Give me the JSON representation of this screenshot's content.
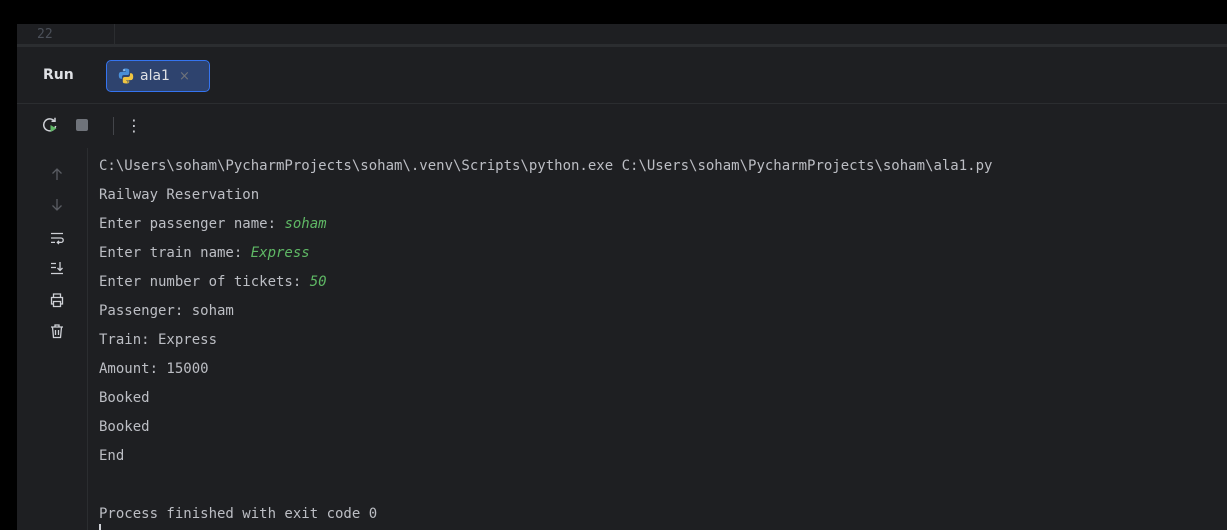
{
  "editor": {
    "line_number": "22"
  },
  "tool_window": {
    "title": "Run",
    "tab": {
      "label": "ala1",
      "icon": "python-icon",
      "close_glyph": "×"
    }
  },
  "toolbar": {
    "rerun_icon": "rerun-icon",
    "stop_icon": "stop-icon",
    "more_glyph": "⋮"
  },
  "side_actions": [
    {
      "name": "scroll-up-icon"
    },
    {
      "name": "scroll-down-icon"
    },
    {
      "name": "soft-wrap-icon"
    },
    {
      "name": "scroll-to-end-icon"
    },
    {
      "name": "print-icon"
    },
    {
      "name": "clear-all-icon"
    }
  ],
  "console": {
    "command": "C:\\Users\\soham\\PycharmProjects\\soham\\.venv\\Scripts\\python.exe C:\\Users\\soham\\PycharmProjects\\soham\\ala1.py",
    "line_heading": "Railway Reservation",
    "prompt_name": "Enter passenger name: ",
    "input_name": "soham",
    "prompt_train": "Enter train name: ",
    "input_train": "Express",
    "prompt_tickets": "Enter number of tickets: ",
    "input_tickets": "50",
    "out_passenger": "Passenger: soham",
    "out_train": "Train: Express",
    "out_amount": "Amount: 15000",
    "out_booked_1": "Booked",
    "out_booked_2": "Booked",
    "out_end": "End",
    "exit_message": "Process finished with exit code 0"
  },
  "colors": {
    "background": "#1e1f22",
    "text": "#bcbec4",
    "user_input": "#5fb865",
    "tab_fill": "#2e436e",
    "tab_border": "#3574f0"
  }
}
